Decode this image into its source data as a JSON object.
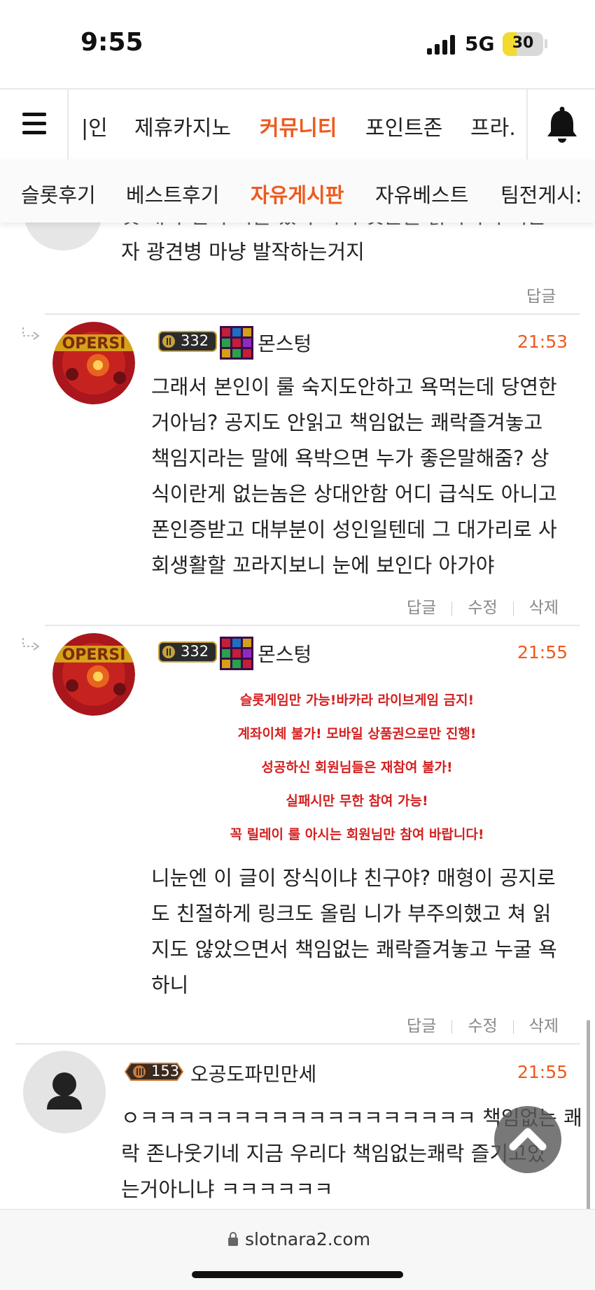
{
  "status_bar": {
    "time": "9:55",
    "network": "5G",
    "battery": "30",
    "battery_level": 0.3
  },
  "top_nav": {
    "menu_icon": "hamburger-menu-icon",
    "items": [
      {
        "label": "|인",
        "active": false
      },
      {
        "label": "제휴카지노",
        "active": false
      },
      {
        "label": "커뮤니티",
        "active": true
      },
      {
        "label": "포인트존",
        "active": false
      },
      {
        "label": "프라.",
        "active": false
      }
    ],
    "bell_icon": "bell-icon"
  },
  "sub_nav": {
    "items": [
      {
        "label": "슬롯후기",
        "active": false
      },
      {
        "label": "베스트후기",
        "active": false
      },
      {
        "label": "자유게시판",
        "active": true
      },
      {
        "label": "자유베스트",
        "active": false
      },
      {
        "label": "팀전게시:",
        "active": false
      }
    ]
  },
  "comments": [
    {
      "partial_text": [
        "것 내가 인저 시물 쳤다 시기 엇글을 밝히되니 니는",
        "자 광견병 마냥 발작하는거지"
      ],
      "actions": [
        "답글"
      ]
    },
    {
      "level": "332",
      "name": "몬스텅",
      "time": "21:53",
      "text": [
        "그래서 본인이 룰 숙지도안하고 욕먹는데 당연한",
        "거아님? 공지도 안읽고 책임없는 쾌락즐겨놓고",
        "책임지라는 말에 욕박으면 누가 좋은말해줌? 상",
        "식이란게 없는놈은 상대안함 어디 급식도 아니고",
        "폰인증받고 대부분이 성인일텐데 그 대가리로 사",
        "회생활할 꼬라지보니 눈에 보인다 아가야"
      ],
      "actions": [
        "답글",
        "수정",
        "삭제"
      ]
    },
    {
      "level": "332",
      "name": "몬스텅",
      "time": "21:55",
      "notice": [
        "슬롯게임만 가능!바카라 라이브게임 금지!",
        "계좌이체 불가! 모바일 상품권으로만 진행!",
        "성공하신 회원님들은 재참여 불가!",
        "실패시만 무한 참여 가능!",
        "꼭 릴레이 룰 아시는 회원님만 참여 바랍니다!"
      ],
      "text": [
        "니눈엔 이 글이 장식이냐 친구야? 매형이 공지로",
        "도 친절하게 링크도 올림 니가 부주의했고 쳐 읽",
        "지도 않았으면서 책임없는 쾌락즐겨놓고 누굴 욕",
        "하니"
      ],
      "actions": [
        "답글",
        "수정",
        "삭제"
      ]
    },
    {
      "level": "153",
      "name": "오공도파민만세",
      "time": "21:55",
      "text": [
        "ㅇㅋㅋㅋㅋㅋㅋㅋㅋㅋㅋㅋㅋㅋㅋㅋㅋㅋㅋ 책임없는 쾌",
        "락 존나웃기네 지금 우리다 책임없는쾌락 즐기고있",
        "는거아니냐 ㅋㅋㅋㅋㅋㅋ"
      ]
    }
  ],
  "icons": {
    "reply_arrow": "reply-arrow-icon",
    "scroll_top": "chevron-up-icon",
    "lock": "lock-icon",
    "default_avatar": "user-silhouette-icon"
  },
  "colors": {
    "accent": "#ee5a1e",
    "notice_red": "#d42020",
    "muted": "#888888"
  },
  "browser": {
    "url": "slotnara2.com"
  }
}
